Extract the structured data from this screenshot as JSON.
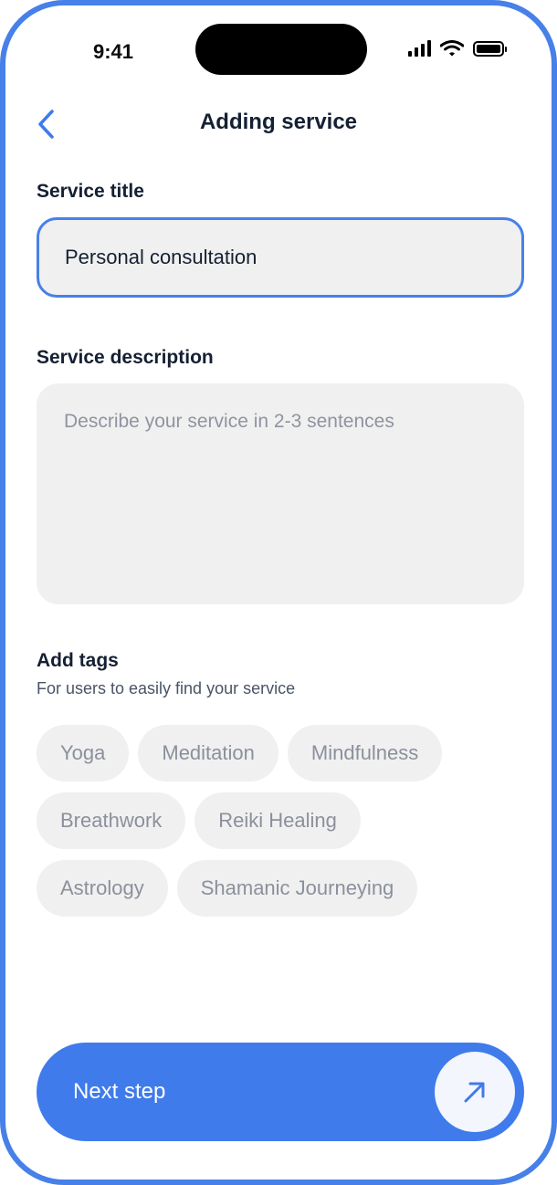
{
  "status_bar": {
    "time": "9:41"
  },
  "header": {
    "title": "Adding service"
  },
  "service_title": {
    "label": "Service title",
    "value": "Personal consultation"
  },
  "service_description": {
    "label": "Service description",
    "placeholder": "Describe your service in 2-3 sentences"
  },
  "tags": {
    "label": "Add tags",
    "subtitle": "For users to easily find your service",
    "items": [
      "Yoga",
      "Meditation",
      "Mindfulness",
      "Breathwork",
      "Reiki Healing",
      "Astrology",
      "Shamanic Journeying"
    ]
  },
  "next_button": {
    "label": "Next step"
  },
  "colors": {
    "accent": "#3f7bea",
    "border": "#4780e8",
    "field_bg": "#f0f0f0",
    "text_dark": "#152033",
    "text_muted": "#8b909c"
  },
  "icons": {
    "back": "chevron-left-icon",
    "next": "arrow-up-right-icon",
    "signal": "cellular-signal-icon",
    "wifi": "wifi-icon",
    "battery": "battery-icon"
  }
}
